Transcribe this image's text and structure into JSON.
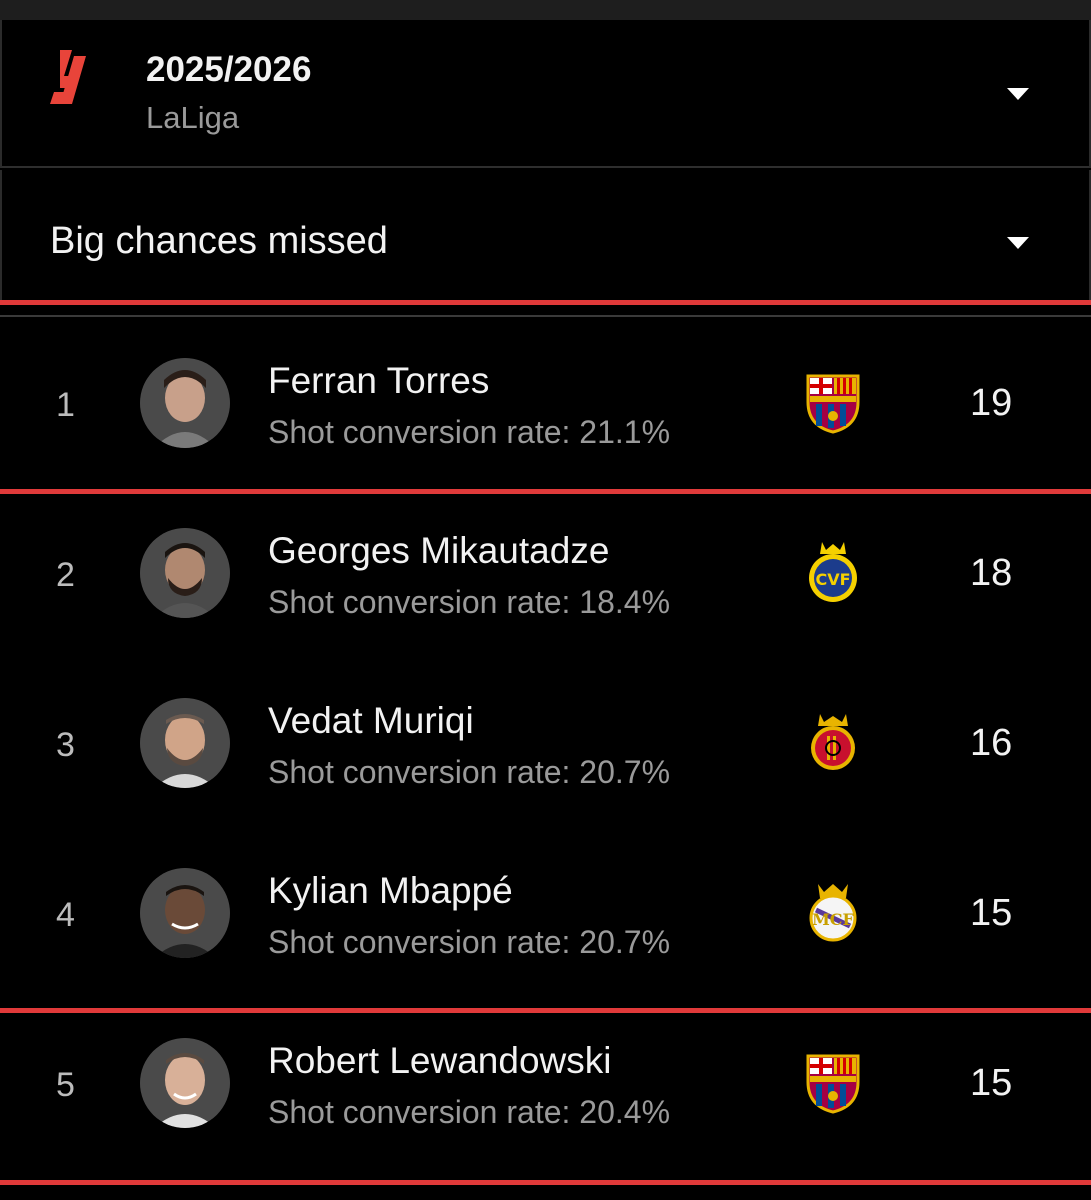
{
  "header": {
    "season": "2025/2026",
    "league": "LaLiga",
    "league_logo_icon": "laliga-logo-icon"
  },
  "stat_selector": {
    "label": "Big chances missed"
  },
  "colors": {
    "accent": "#e03a3a",
    "background": "#000000",
    "muted_text": "#9a9a9a"
  },
  "players": [
    {
      "rank": "1",
      "name": "Ferran Torres",
      "sub": "Shot conversion rate: 21.1%",
      "club_icon": "fc-barcelona-crest-icon",
      "value": "19"
    },
    {
      "rank": "2",
      "name": "Georges Mikautadze",
      "sub": "Shot conversion rate: 18.4%",
      "club_icon": "villarreal-crest-icon",
      "value": "18"
    },
    {
      "rank": "3",
      "name": "Vedat Muriqi",
      "sub": "Shot conversion rate: 20.7%",
      "club_icon": "mallorca-crest-icon",
      "value": "16"
    },
    {
      "rank": "4",
      "name": "Kylian Mbappé",
      "sub": "Shot conversion rate: 20.7%",
      "club_icon": "real-madrid-crest-icon",
      "value": "15"
    },
    {
      "rank": "5",
      "name": "Robert Lewandowski",
      "sub": "Shot conversion rate: 20.4%",
      "club_icon": "fc-barcelona-crest-icon",
      "value": "15"
    }
  ]
}
